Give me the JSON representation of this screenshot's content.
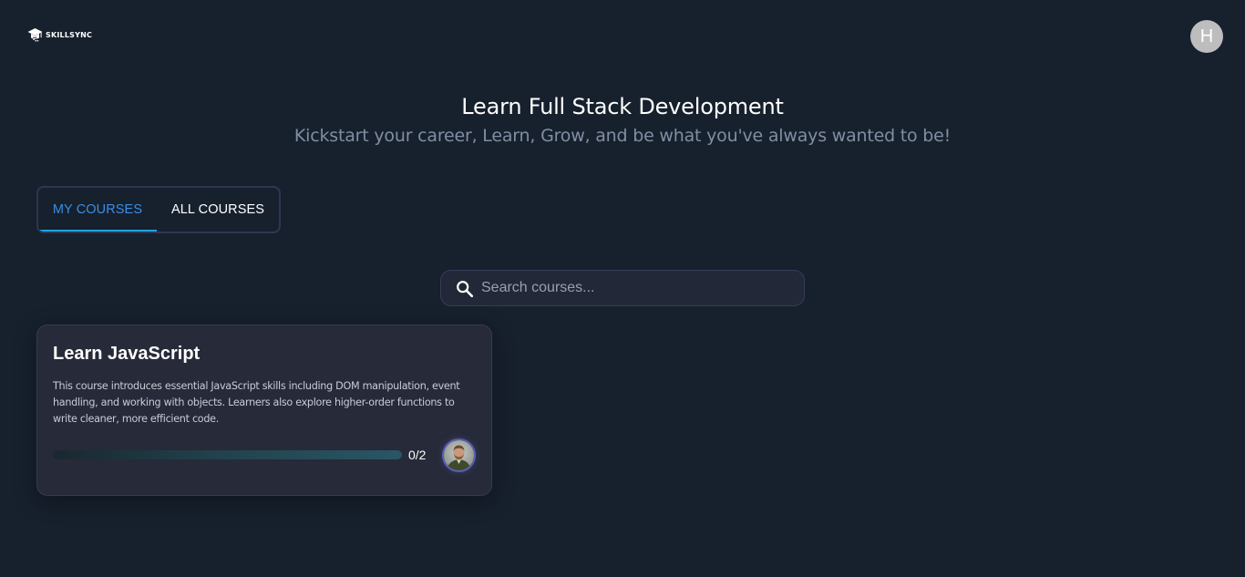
{
  "header": {
    "logo_text": "SKILLSYNC",
    "avatar_initial": "H"
  },
  "hero": {
    "title": "Learn Full Stack Development",
    "subtitle": "Kickstart your career, Learn, Grow, and be what you've always wanted to be!"
  },
  "tabs": [
    {
      "label": "MY COURSES",
      "active": true
    },
    {
      "label": "ALL COURSES",
      "active": false
    }
  ],
  "search": {
    "placeholder": "Search courses...",
    "value": ""
  },
  "courses": [
    {
      "title": "Learn JavaScript",
      "description": "This course introduces essential JavaScript skills including DOM manipulation, event handling, and working with objects. Learners also explore higher-order functions to write cleaner, more efficient code.",
      "progress_text": "0/2",
      "progress_completed": 0,
      "progress_total": 2,
      "instructor_icon": "instructor-avatar"
    }
  ],
  "colors": {
    "background": "#17202d",
    "accent": "#1ea4e0",
    "active_tab": "#3a8ee6",
    "card": "#262a39"
  }
}
